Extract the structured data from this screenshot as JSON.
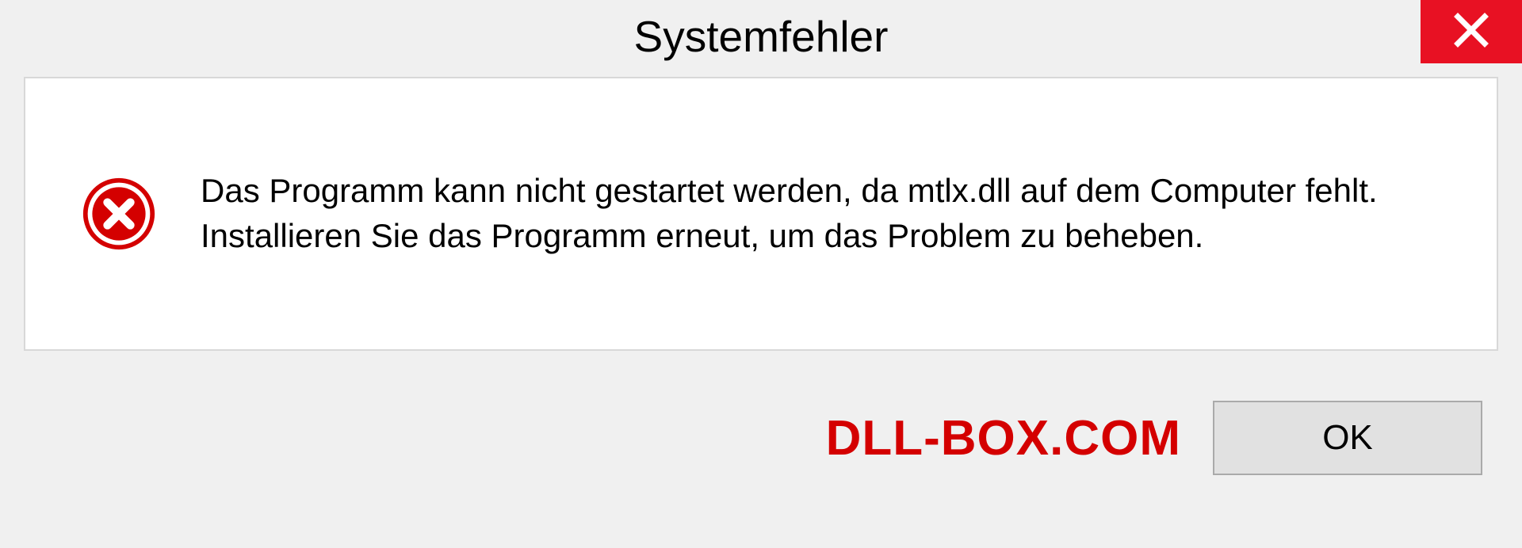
{
  "dialog": {
    "title": "Systemfehler",
    "message": "Das Programm kann nicht gestartet werden, da mtlx.dll auf dem Computer fehlt. Installieren Sie das Programm erneut, um das Problem zu beheben.",
    "ok_label": "OK"
  },
  "watermark": "DLL-BOX.COM",
  "colors": {
    "close_button": "#e81123",
    "error_icon": "#d40000",
    "watermark": "#d40000"
  }
}
